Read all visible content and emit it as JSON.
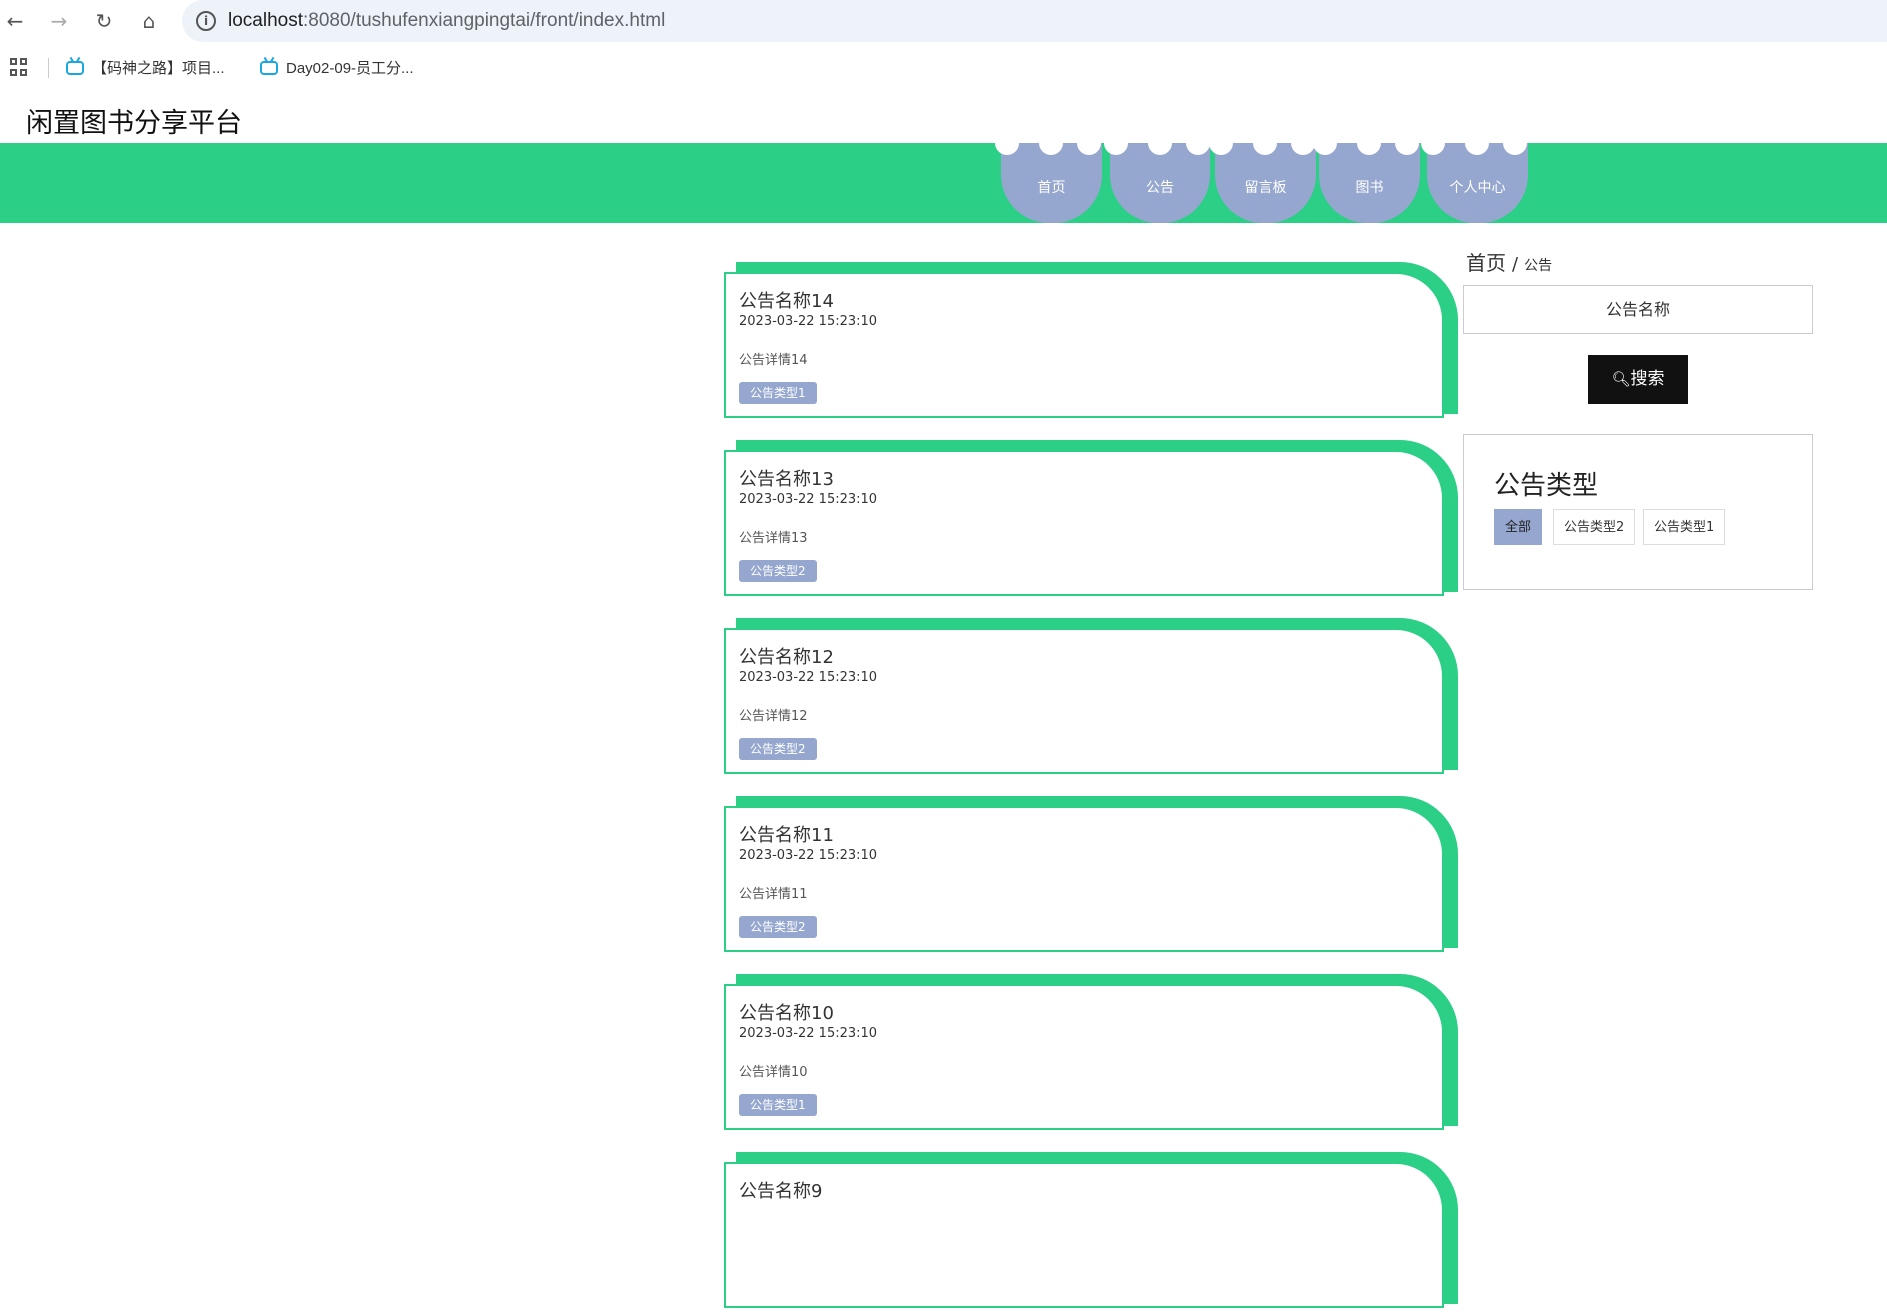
{
  "browser": {
    "url_host": "localhost",
    "url_rest": ":8080/tushufenxiangpingtai/front/index.html",
    "bookmarks": [
      "【码神之路】项目...",
      "Day02-09-员工分..."
    ]
  },
  "site": {
    "title": "闲置图书分享平台"
  },
  "nav": {
    "items": [
      {
        "label": "首页"
      },
      {
        "label": "公告"
      },
      {
        "label": "留言板"
      },
      {
        "label": "图书"
      },
      {
        "label": "个人中心"
      }
    ]
  },
  "announcements": [
    {
      "name": "公告名称14",
      "time": "2023-03-22 15:23:10",
      "detail": "公告详情14",
      "type": "公告类型1"
    },
    {
      "name": "公告名称13",
      "time": "2023-03-22 15:23:10",
      "detail": "公告详情13",
      "type": "公告类型2"
    },
    {
      "name": "公告名称12",
      "time": "2023-03-22 15:23:10",
      "detail": "公告详情12",
      "type": "公告类型2"
    },
    {
      "name": "公告名称11",
      "time": "2023-03-22 15:23:10",
      "detail": "公告详情11",
      "type": "公告类型2"
    },
    {
      "name": "公告名称10",
      "time": "2023-03-22 15:23:10",
      "detail": "公告详情10",
      "type": "公告类型1"
    },
    {
      "name": "公告名称9",
      "time": "",
      "detail": "",
      "type": ""
    }
  ],
  "sidebar": {
    "breadcrumb": {
      "home": "首页",
      "separator": "/",
      "current": "公告"
    },
    "search_placeholder": "公告名称",
    "search_button": "搜索",
    "type_panel": {
      "title": "公告类型",
      "buttons": [
        "全部",
        "公告类型2",
        "公告类型1"
      ]
    }
  },
  "colors": {
    "accent_green": "#2bcf86",
    "accent_blue": "#95a7cf"
  }
}
